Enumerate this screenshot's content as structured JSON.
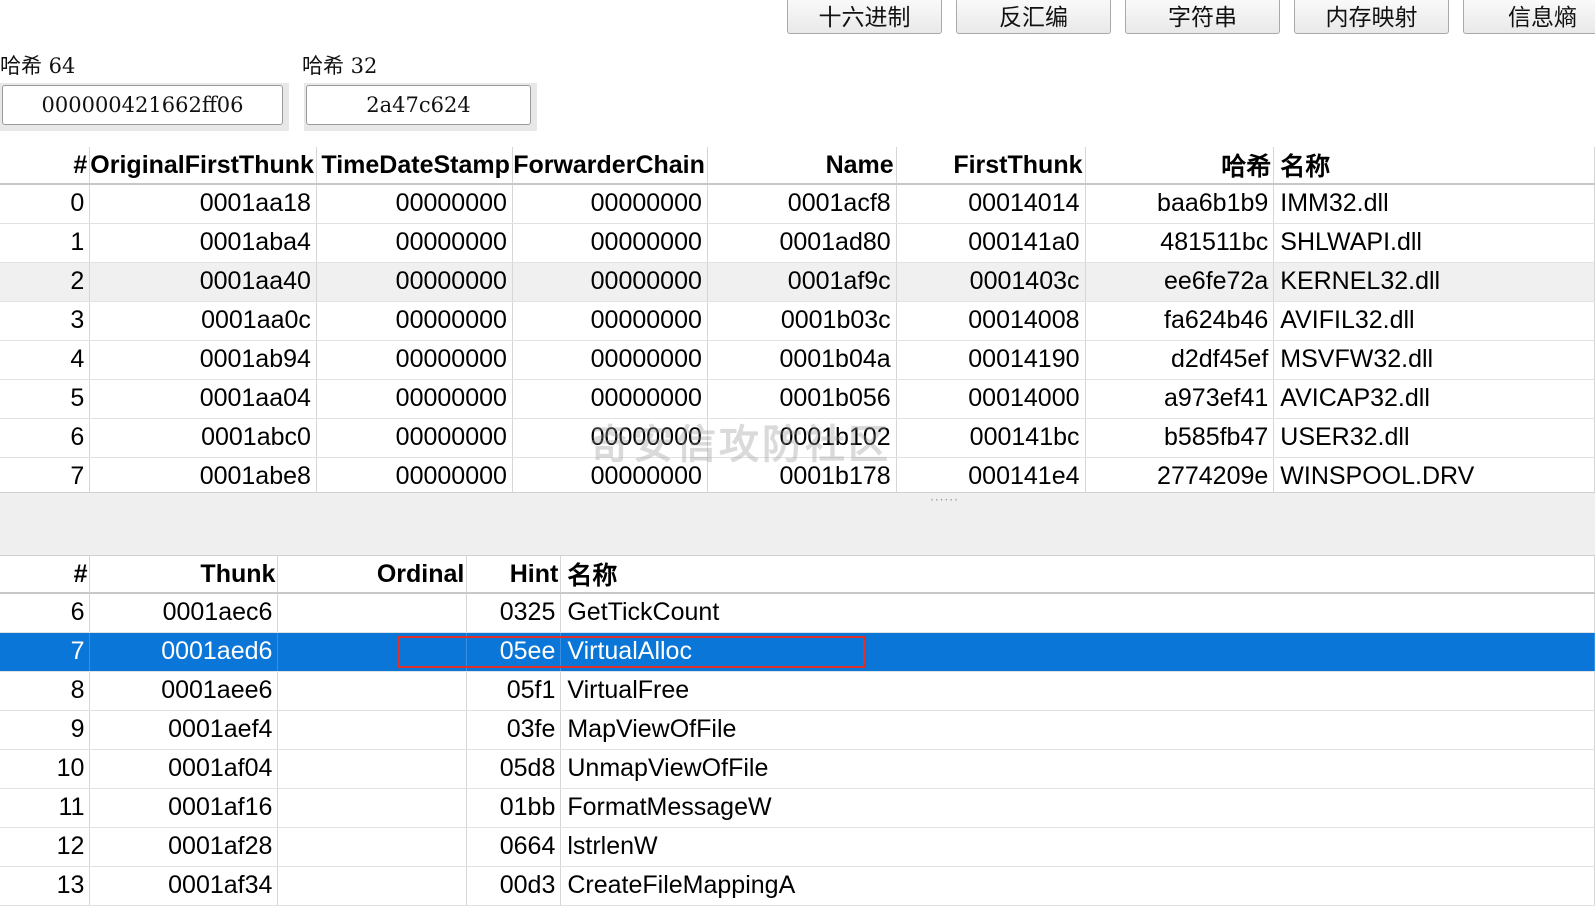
{
  "toolbar": {
    "buttons": [
      "十六进制",
      "反汇编",
      "字符串",
      "内存映射",
      "信息熵"
    ]
  },
  "hash64": {
    "label": "哈希 64",
    "value": "000000421662ff06"
  },
  "hash32": {
    "label": "哈希 32",
    "value": "2a47c624"
  },
  "import_table": {
    "columns": [
      "#",
      "OriginalFirstThunk",
      "TimeDateStamp",
      "ForwarderChain",
      "Name",
      "FirstThunk",
      "哈希",
      "名称"
    ],
    "rows": [
      [
        "0",
        "0001aa18",
        "00000000",
        "00000000",
        "0001acf8",
        "00014014",
        "baa6b1b9",
        "IMM32.dll"
      ],
      [
        "1",
        "0001aba4",
        "00000000",
        "00000000",
        "0001ad80",
        "000141a0",
        "481511bc",
        "SHLWAPI.dll"
      ],
      [
        "2",
        "0001aa40",
        "00000000",
        "00000000",
        "0001af9c",
        "0001403c",
        "ee6fe72a",
        "KERNEL32.dll"
      ],
      [
        "3",
        "0001aa0c",
        "00000000",
        "00000000",
        "0001b03c",
        "00014008",
        "fa624b46",
        "AVIFIL32.dll"
      ],
      [
        "4",
        "0001ab94",
        "00000000",
        "00000000",
        "0001b04a",
        "00014190",
        "d2df45ef",
        "MSVFW32.dll"
      ],
      [
        "5",
        "0001aa04",
        "00000000",
        "00000000",
        "0001b056",
        "00014000",
        "a973ef41",
        "AVICAP32.dll"
      ],
      [
        "6",
        "0001abc0",
        "00000000",
        "00000000",
        "0001b102",
        "000141bc",
        "b585fb47",
        "USER32.dll"
      ],
      [
        "7",
        "0001abe8",
        "00000000",
        "00000000",
        "0001b178",
        "000141e4",
        "2774209e",
        "WINSPOOL.DRV"
      ]
    ]
  },
  "function_table": {
    "columns": [
      "#",
      "Thunk",
      "Ordinal",
      "Hint",
      "名称"
    ],
    "rows": [
      [
        "6",
        "0001aec6",
        "",
        "0325",
        "GetTickCount"
      ],
      [
        "7",
        "0001aed6",
        "",
        "05ee",
        "VirtualAlloc"
      ],
      [
        "8",
        "0001aee6",
        "",
        "05f1",
        "VirtualFree"
      ],
      [
        "9",
        "0001aef4",
        "",
        "03fe",
        "MapViewOfFile"
      ],
      [
        "10",
        "0001af04",
        "",
        "05d8",
        "UnmapViewOfFile"
      ],
      [
        "11",
        "0001af16",
        "",
        "01bb",
        "FormatMessageW"
      ],
      [
        "12",
        "0001af28",
        "",
        "0664",
        "lstrlenW"
      ],
      [
        "13",
        "0001af34",
        "",
        "00d3",
        "CreateFileMappingA"
      ]
    ],
    "selected_row": 1
  },
  "watermark": "奇安信攻防社区",
  "colors": {
    "selection": "#0a76d8",
    "highlight_border": "#e0302a"
  }
}
